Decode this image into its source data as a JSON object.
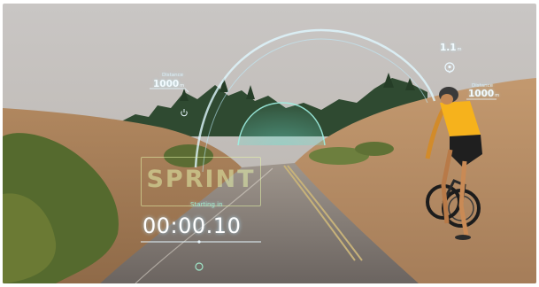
{
  "hud": {
    "left_distance": {
      "label": "Distance",
      "value": "1000",
      "unit": "m"
    },
    "right_distance": {
      "label": "Distance",
      "value": "1000",
      "unit": "m"
    },
    "marker_distance": {
      "value": "1.1",
      "unit": "m"
    },
    "mode_label": "SPRINT",
    "countdown_label": "Starting in",
    "countdown_time": "00:00.10"
  },
  "colors": {
    "hud_glow": "#bfefff",
    "sprint_box": "#e1eeaa",
    "countdown_accent": "#9fe6c9",
    "jersey": "#f6b21c"
  },
  "icons": [
    "location-pin-icon",
    "power-icon",
    "center-dot-icon"
  ]
}
